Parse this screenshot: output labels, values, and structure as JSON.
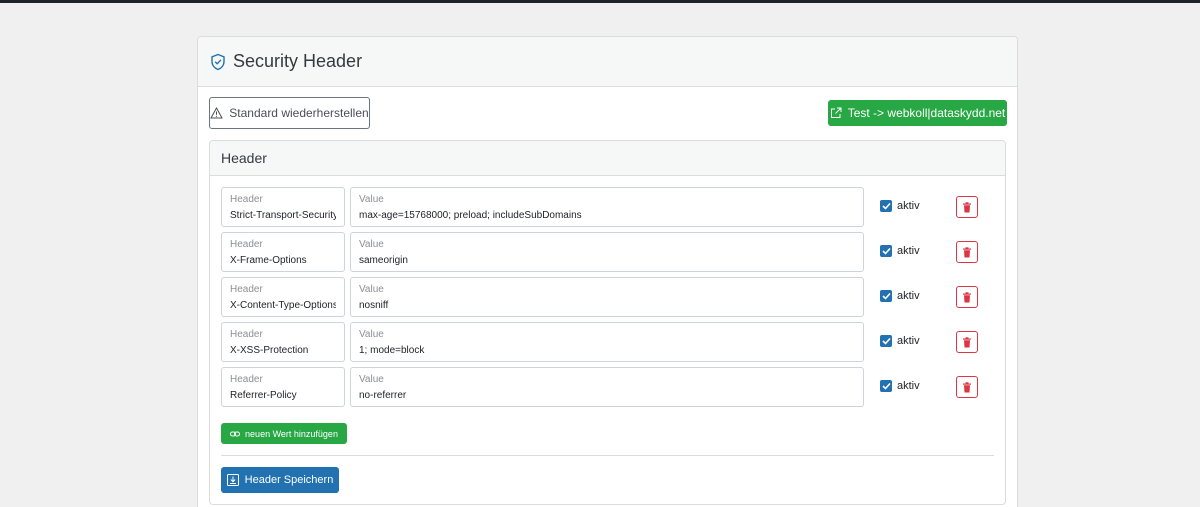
{
  "page": {
    "title": "Security Header"
  },
  "actions": {
    "restore_label": "Standard wiederherstellen",
    "test_label": "Test -> webkoll|dataskydd.net"
  },
  "section": {
    "title": "Header"
  },
  "rows": [
    {
      "header_label": "Header",
      "header_value": "Strict-Transport-Security",
      "value_label": "Value",
      "value": "max-age=15768000; preload; includeSubDomains",
      "active_label": "aktiv",
      "active": true
    },
    {
      "header_label": "Header",
      "header_value": "X-Frame-Options",
      "value_label": "Value",
      "value": "sameorigin",
      "active_label": "aktiv",
      "active": true
    },
    {
      "header_label": "Header",
      "header_value": "X-Content-Type-Options",
      "value_label": "Value",
      "value": "nosniff",
      "active_label": "aktiv",
      "active": true
    },
    {
      "header_label": "Header",
      "header_value": "X-XSS-Protection",
      "value_label": "Value",
      "value": "1; mode=block",
      "active_label": "aktiv",
      "active": true
    },
    {
      "header_label": "Header",
      "header_value": "Referrer-Policy",
      "value_label": "Value",
      "value": "no-referrer",
      "active_label": "aktiv",
      "active": true
    }
  ],
  "footer": {
    "add_label": "neuen Wert hinzufügen",
    "save_label": "Header Speichern"
  },
  "colors": {
    "primary": "#2271b1",
    "success": "#28a745",
    "danger": "#dc3545"
  },
  "icons": {
    "title": "shield-check-icon",
    "restore": "warning-icon",
    "test": "external-link-icon",
    "delete": "trash-icon",
    "add": "link-icon",
    "save": "download-icon"
  }
}
